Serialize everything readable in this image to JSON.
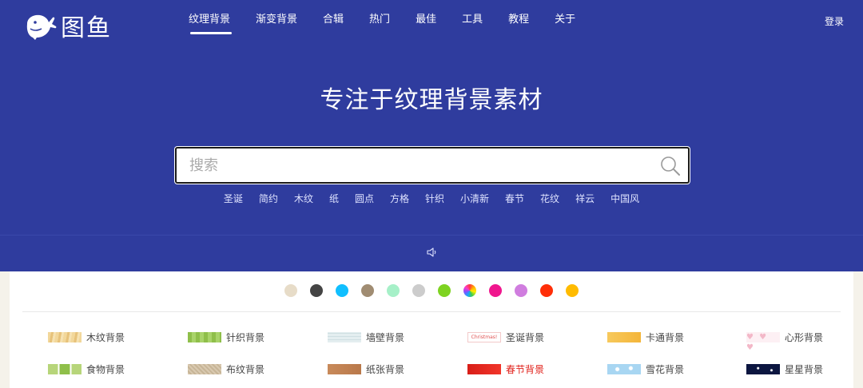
{
  "brand": {
    "name": "图鱼"
  },
  "nav": {
    "items": [
      {
        "label": "纹理背景",
        "active": true
      },
      {
        "label": "渐变背景"
      },
      {
        "label": "合辑"
      },
      {
        "label": "热门"
      },
      {
        "label": "最佳"
      },
      {
        "label": "工具"
      },
      {
        "label": "教程"
      },
      {
        "label": "关于"
      }
    ],
    "login": "登录"
  },
  "hero": {
    "headline": "专注于纹理背景素材"
  },
  "search": {
    "placeholder": "搜索"
  },
  "tags": [
    "圣诞",
    "简约",
    "木纹",
    "纸",
    "圆点",
    "方格",
    "针织",
    "小清新",
    "春节",
    "花纹",
    "祥云",
    "中国风"
  ],
  "color_filters": [
    "#e7dcc8",
    "#444444",
    "#10bfff",
    "#a08c72",
    "#a6f0c8",
    "#cccccc",
    "#7ed321",
    "rainbow",
    "#f0168e",
    "#d07ddf",
    "#ff2e08",
    "#ffbb00"
  ],
  "categories": [
    {
      "label": "木纹背景",
      "thumb": "wood"
    },
    {
      "label": "针织背景",
      "thumb": "knit"
    },
    {
      "label": "墙壁背景",
      "thumb": "wall"
    },
    {
      "label": "圣诞背景",
      "thumb": "christmas",
      "thumb_text": "Christmas!"
    },
    {
      "label": "卡通背景",
      "thumb": "cartoon"
    },
    {
      "label": "心形背景",
      "thumb": "heart"
    },
    {
      "label": "食物背景",
      "thumb": "food"
    },
    {
      "label": "布纹背景",
      "thumb": "fabric"
    },
    {
      "label": "纸张背景",
      "thumb": "paper"
    },
    {
      "label": "春节背景",
      "thumb": "springfestival",
      "highlight": "#e0201a"
    },
    {
      "label": "雪花背景",
      "thumb": "snow"
    },
    {
      "label": "星星背景",
      "thumb": "stars"
    }
  ]
}
